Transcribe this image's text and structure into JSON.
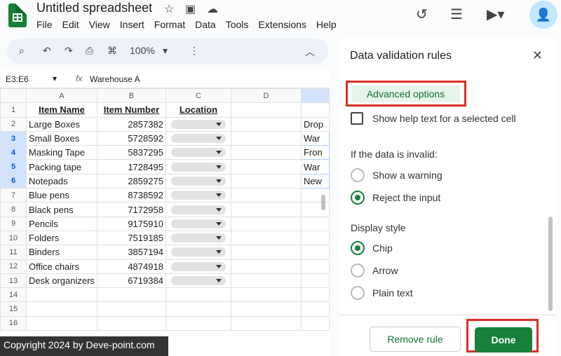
{
  "app": {
    "title": "Untitled spreadsheet",
    "menu": [
      "File",
      "Edit",
      "View",
      "Insert",
      "Format",
      "Data",
      "Tools",
      "Extensions",
      "Help"
    ]
  },
  "toolbar": {
    "zoom": "100%"
  },
  "formula": {
    "cell_ref": "E3:E6",
    "fx": "fx",
    "value": "Warehouse A"
  },
  "grid": {
    "columns": [
      "A",
      "B",
      "C",
      "D"
    ],
    "headers": {
      "a": "Item Name",
      "b": "Item Number",
      "c": "Location"
    },
    "rows": [
      {
        "n": "1"
      },
      {
        "n": "2",
        "a": "Large Boxes",
        "b": "2857382",
        "e": "Drop"
      },
      {
        "n": "3",
        "a": "Small Boxes",
        "b": "5728592",
        "e": "War"
      },
      {
        "n": "4",
        "a": "Masking Tape",
        "b": "5837295",
        "e": "Fron"
      },
      {
        "n": "5",
        "a": "Packing tape",
        "b": "1728495",
        "e": "War"
      },
      {
        "n": "6",
        "a": "Notepads",
        "b": "2859275",
        "e": "New"
      },
      {
        "n": "7",
        "a": "Blue pens",
        "b": "8738592"
      },
      {
        "n": "8",
        "a": "Black pens",
        "b": "7172958"
      },
      {
        "n": "9",
        "a": "Pencils",
        "b": "9175910"
      },
      {
        "n": "10",
        "a": "Folders",
        "b": "7519185"
      },
      {
        "n": "11",
        "a": "Binders",
        "b": "3857194"
      },
      {
        "n": "12",
        "a": "Office chairs",
        "b": "4874918"
      },
      {
        "n": "13",
        "a": "Desk organizers",
        "b": "6719384"
      },
      {
        "n": "14"
      },
      {
        "n": "15"
      },
      {
        "n": "16"
      }
    ]
  },
  "panel": {
    "title": "Data validation rules",
    "advanced": "Advanced options",
    "help_text": "Show help text for a selected cell",
    "invalid_label": "If the data is invalid:",
    "show_warning": "Show a warning",
    "reject": "Reject the input",
    "display_label": "Display style",
    "chip": "Chip",
    "arrow": "Arrow",
    "plain": "Plain text",
    "remove": "Remove rule",
    "done": "Done"
  },
  "watermark": "Copyright 2024 by Deve-point.com"
}
